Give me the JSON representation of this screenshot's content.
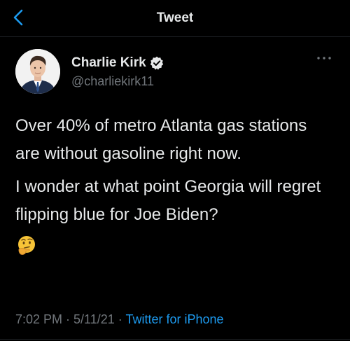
{
  "nav": {
    "title": "Tweet"
  },
  "author": {
    "display_name": "Charlie Kirk",
    "handle": "@charliekirk11",
    "verified": true
  },
  "tweet": {
    "paragraphs": [
      "Over 40% of metro Atlanta gas stations are without gasoline right now.",
      "I wonder at what point Georgia will regret flipping blue for Joe Biden?"
    ],
    "emoji": "thinking-face"
  },
  "meta": {
    "time": "7:02 PM",
    "separator": " · ",
    "date": "5/11/21",
    "source": "Twitter for iPhone"
  },
  "colors": {
    "background": "#000000",
    "text_primary": "#e7e9ea",
    "text_secondary": "#71767b",
    "accent": "#1d9bf0"
  }
}
